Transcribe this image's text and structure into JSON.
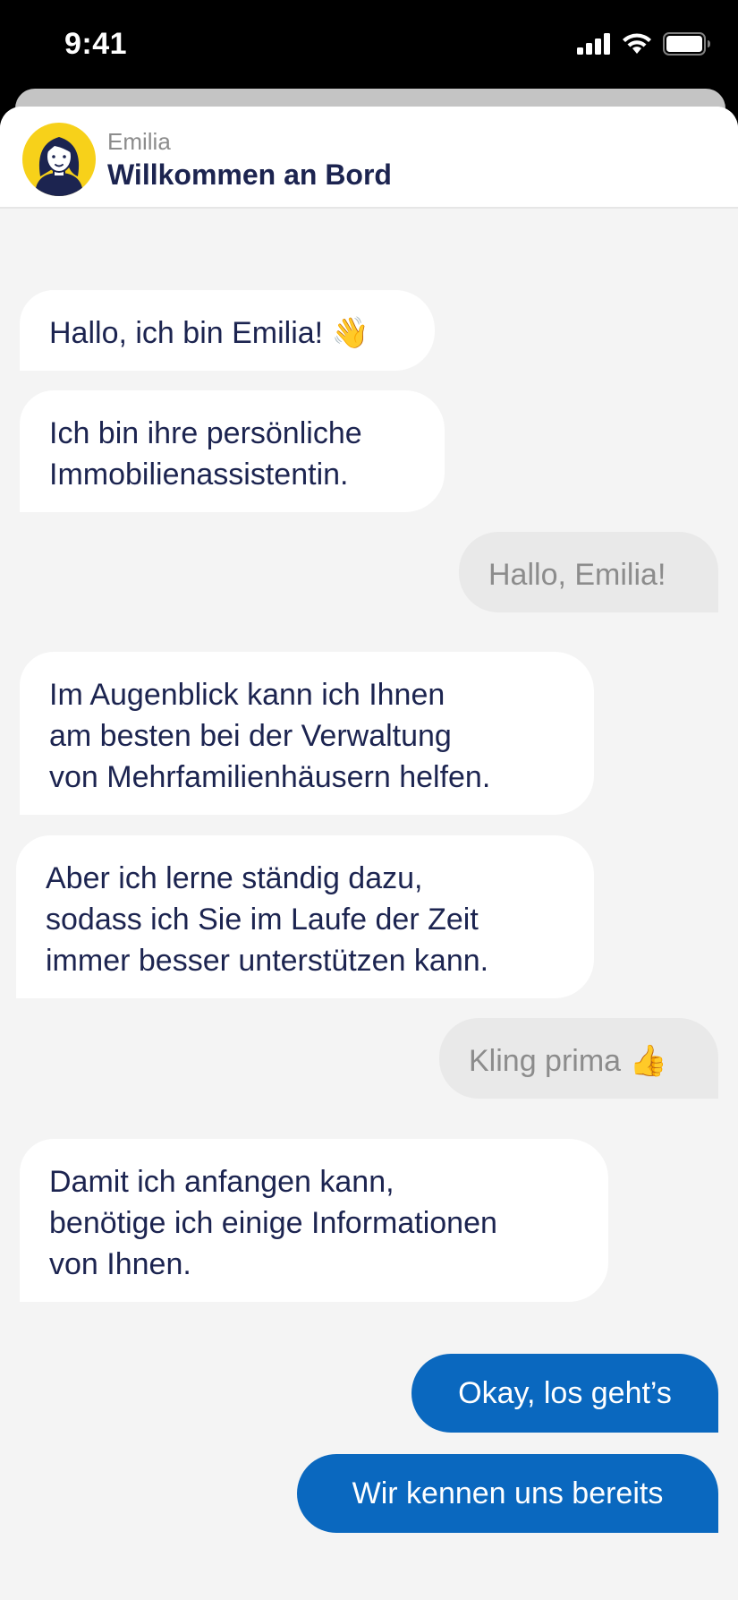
{
  "status_bar": {
    "time": "9:41"
  },
  "header": {
    "assistant_name": "Emilia",
    "title": "Willkommen an Bord"
  },
  "messages": [
    {
      "from": "assistant",
      "text": "Hallo, ich bin Emilia! 👋"
    },
    {
      "from": "assistant",
      "lines": [
        "Ich bin ihre persönliche",
        "Immobilienassistentin."
      ]
    },
    {
      "from": "user",
      "text": "Hallo, Emilia!"
    },
    {
      "from": "assistant",
      "lines": [
        "Im Augenblick kann ich Ihnen",
        "am besten bei der Verwaltung",
        "von Mehrfamilienhäusern helfen."
      ]
    },
    {
      "from": "assistant",
      "lines": [
        "Aber ich lerne ständig dazu,",
        "sodass ich Sie im Laufe der Zeit",
        "immer besser unterstützen kann."
      ]
    },
    {
      "from": "user",
      "text": "Kling prima 👍"
    },
    {
      "from": "assistant",
      "lines": [
        "Damit ich anfangen kann,",
        "benötige ich einige Informationen",
        "von Ihnen."
      ]
    }
  ],
  "actions": {
    "start_label": "Okay, los geht’s",
    "known_label": "Wir kennen uns bereits"
  },
  "colors": {
    "accent": "#0a68bf",
    "avatar_bg": "#f7d11a",
    "text_dark": "#1c2450",
    "background": "#f4f4f4"
  }
}
